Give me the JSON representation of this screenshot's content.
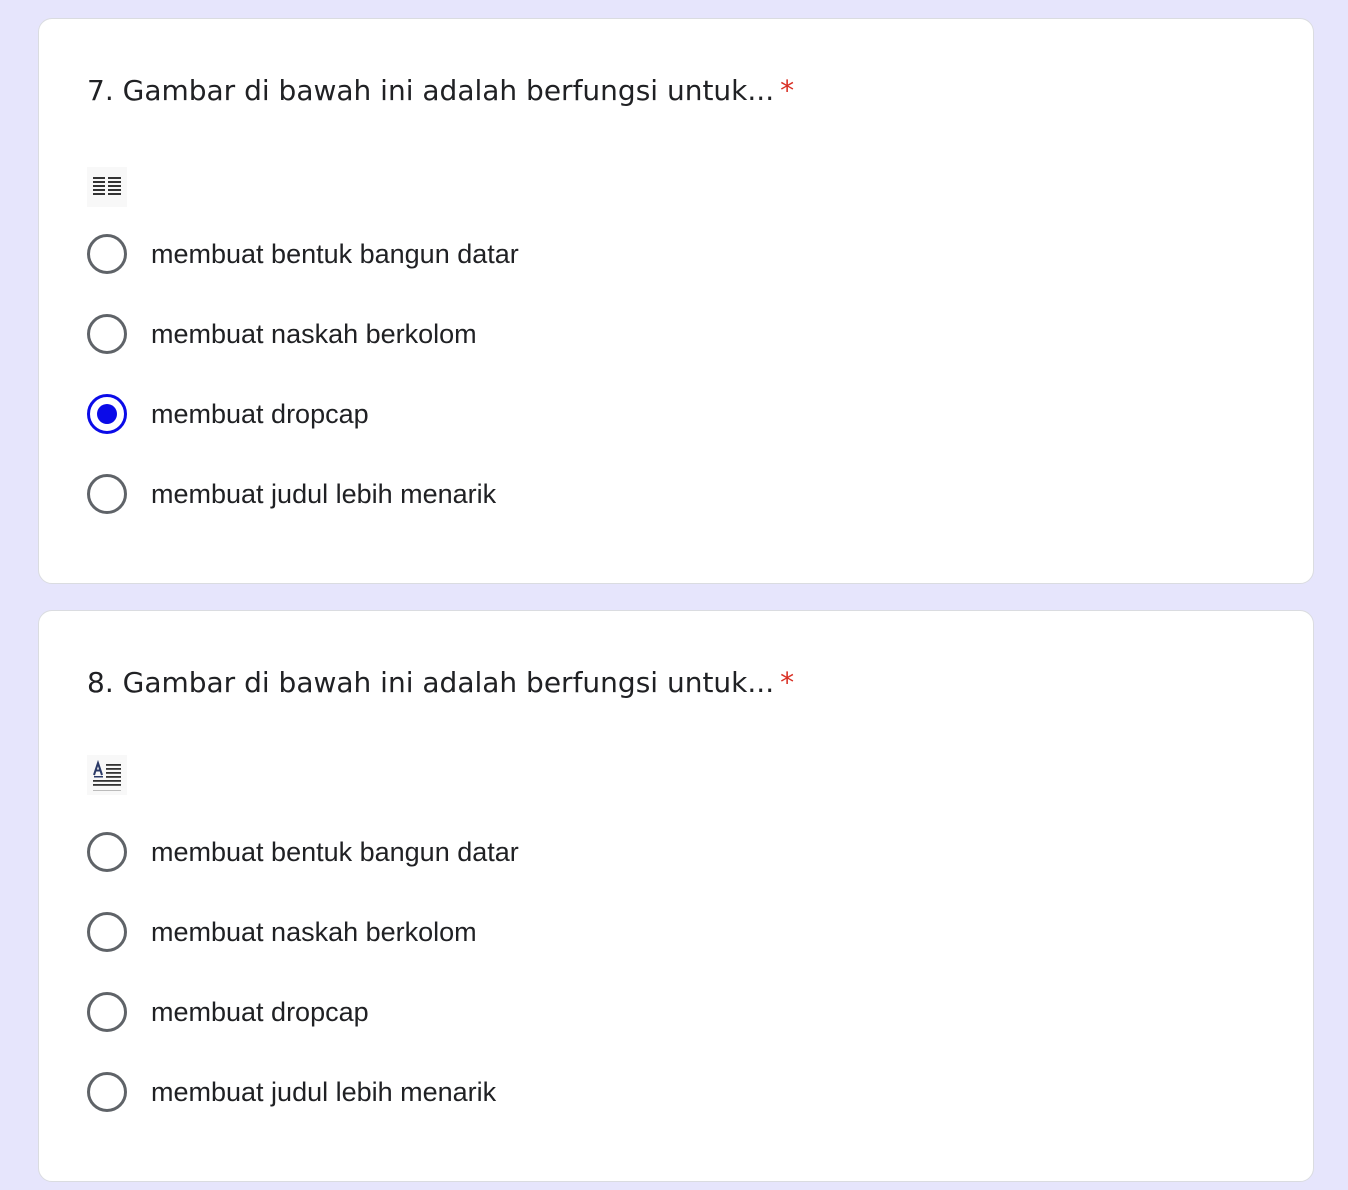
{
  "questions": [
    {
      "number_title": "7. Gambar di bawah ini adalah berfungsi untuk...",
      "required_mark": "*",
      "image_icon": "columns-icon",
      "options": [
        {
          "label": "membuat bentuk bangun datar",
          "selected": false
        },
        {
          "label": "membuat naskah berkolom",
          "selected": false
        },
        {
          "label": "membuat dropcap",
          "selected": true
        },
        {
          "label": "membuat judul lebih menarik",
          "selected": false
        }
      ]
    },
    {
      "number_title": "8. Gambar di bawah ini adalah berfungsi untuk...",
      "required_mark": "*",
      "image_icon": "dropcap-icon",
      "options": [
        {
          "label": "membuat bentuk bangun datar",
          "selected": false
        },
        {
          "label": "membuat naskah berkolom",
          "selected": false
        },
        {
          "label": "membuat dropcap",
          "selected": false
        },
        {
          "label": "membuat judul lebih menarik",
          "selected": false
        }
      ]
    }
  ],
  "colors": {
    "page_background": "#e6e5fc",
    "card_background": "#ffffff",
    "required": "#d93025",
    "radio_selected": "#0b0be8",
    "radio_unselected": "#5f6368"
  }
}
